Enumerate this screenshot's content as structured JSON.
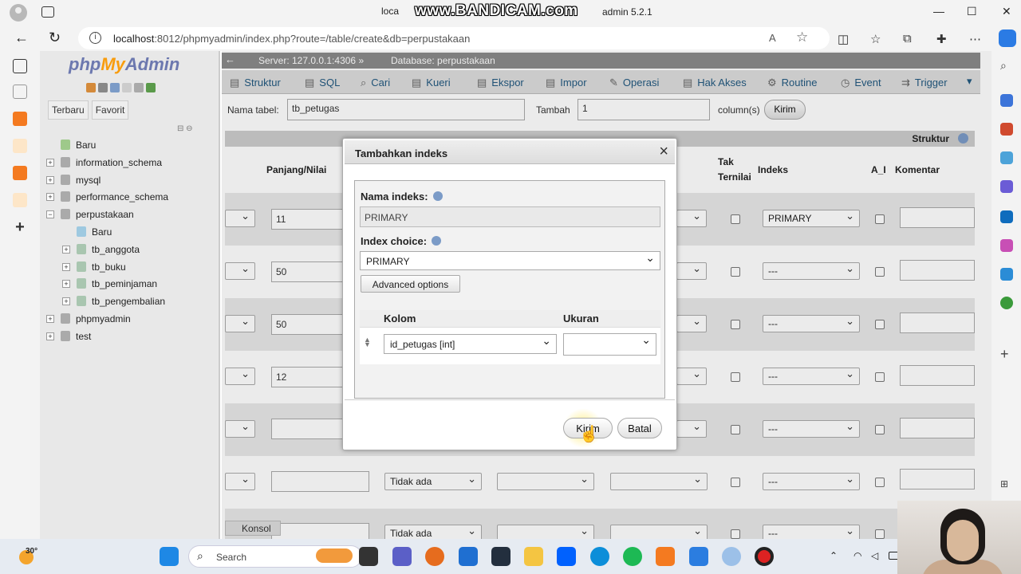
{
  "browser": {
    "title_left": "loca",
    "watermark": "www.BANDICAM.com",
    "title_right": "admin 5.2.1",
    "url_host": "localhost",
    "url_rest": ":8012/phpmyadmin/index.php?route=/table/create&db=perpustakaan",
    "reader_label": "A",
    "minimize": "—",
    "maximize": "☐",
    "close": "✕"
  },
  "pma": {
    "logo_php": "php",
    "logo_my": "My",
    "logo_admin": "Admin",
    "nav_tabs": [
      "Terbaru",
      "Favorit"
    ],
    "tree": [
      {
        "label": "Baru",
        "level": 0,
        "expander": ""
      },
      {
        "label": "information_schema",
        "level": 0,
        "expander": "+"
      },
      {
        "label": "mysql",
        "level": 0,
        "expander": "+"
      },
      {
        "label": "performance_schema",
        "level": 0,
        "expander": "+"
      },
      {
        "label": "perpustakaan",
        "level": 0,
        "expander": "−"
      },
      {
        "label": "Baru",
        "level": 1,
        "expander": ""
      },
      {
        "label": "tb_anggota",
        "level": 1,
        "expander": "+"
      },
      {
        "label": "tb_buku",
        "level": 1,
        "expander": "+"
      },
      {
        "label": "tb_peminjaman",
        "level": 1,
        "expander": "+"
      },
      {
        "label": "tb_pengembalian",
        "level": 1,
        "expander": "+"
      },
      {
        "label": "phpmyadmin",
        "level": 0,
        "expander": "+"
      },
      {
        "label": "test",
        "level": 0,
        "expander": "+"
      }
    ],
    "breadcrumb": {
      "server": "Server: 127.0.0.1:4306",
      "sep": "»",
      "database": "Database: perpustakaan"
    },
    "menu": [
      "Struktur",
      "SQL",
      "Cari",
      "Kueri",
      "Ekspor",
      "Impor",
      "Operasi",
      "Hak Akses",
      "Routine",
      "Event",
      "Trigger"
    ],
    "create": {
      "table_name_label": "Nama tabel:",
      "table_name_value": "tb_petugas",
      "add_label": "Tambah",
      "add_value": "1",
      "columns_label": "column(s)",
      "submit": "Kirim"
    },
    "struktur_label": "Struktur",
    "col_headers": {
      "length": "Panjang/Nilai",
      "null1": "Tak",
      "null2": "Ternilai",
      "index": "Indeks",
      "ai": "A_I",
      "comment": "Komentar"
    },
    "rows": [
      {
        "length": "11",
        "index": "PRIMARY"
      },
      {
        "length": "50",
        "index": "---"
      },
      {
        "length": "50",
        "index": "---"
      },
      {
        "length": "12",
        "index": "---"
      },
      {
        "length": "",
        "index": "---"
      },
      {
        "length": "",
        "index": "---",
        "default": "Tidak ada"
      },
      {
        "length": "",
        "index": "---",
        "default": "Tidak ada"
      }
    ],
    "konsol": "Konsol"
  },
  "dialog": {
    "title": "Tambahkan indeks",
    "index_name_label": "Nama indeks:",
    "index_name_value": "PRIMARY",
    "index_choice_label": "Index choice:",
    "index_choice_value": "PRIMARY",
    "advanced": "Advanced options",
    "col_header": "Kolom",
    "size_header": "Ukuran",
    "column_value": "id_petugas [int]",
    "size_value": "",
    "submit": "Kirim",
    "cancel": "Batal"
  },
  "taskbar": {
    "temperature": "30°",
    "search_placeholder": "Search"
  },
  "colors": {
    "pma_blue": "#235a81",
    "logo_blue": "#6c78af",
    "logo_orange": "#f89c0e"
  }
}
